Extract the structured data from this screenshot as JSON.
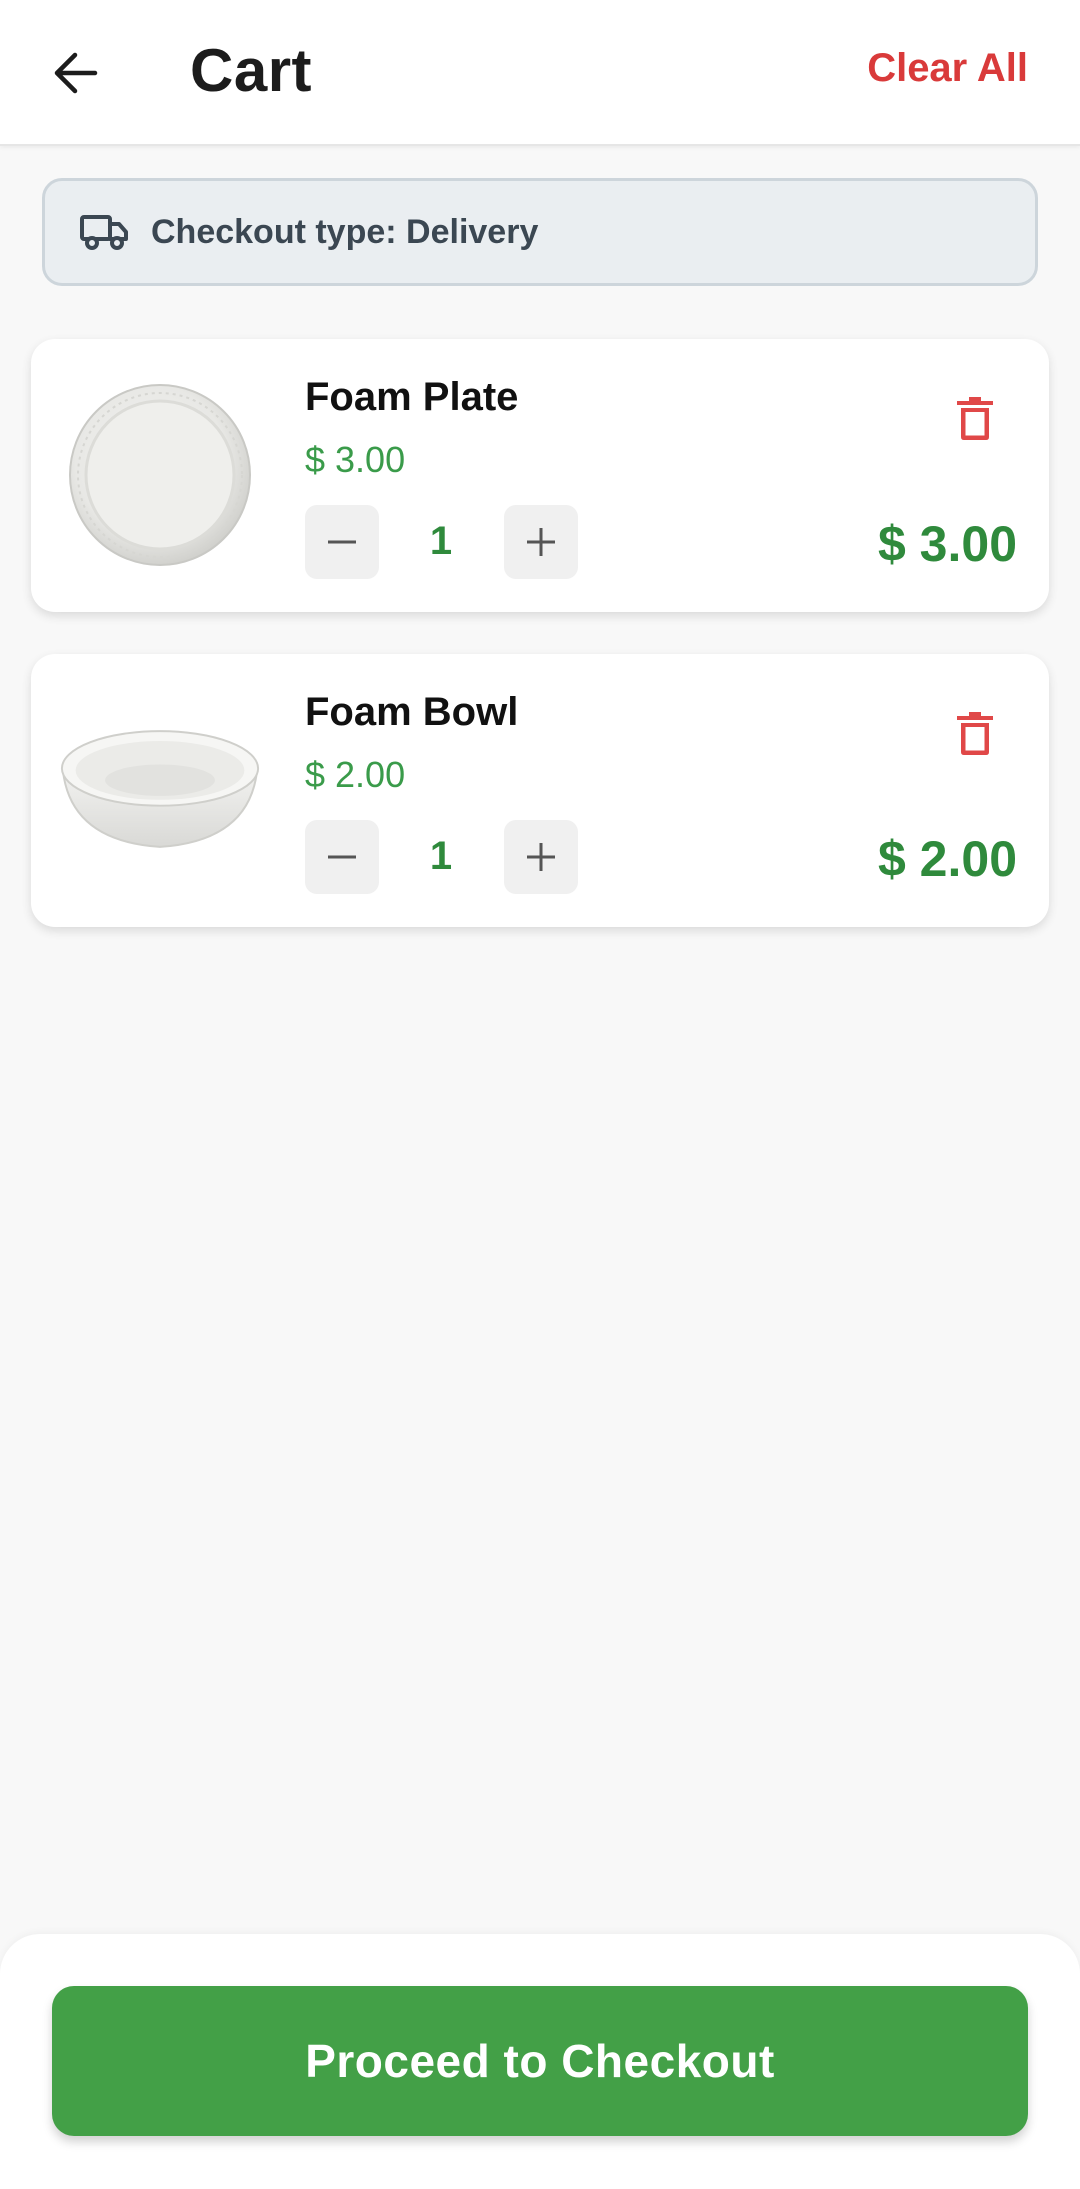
{
  "header": {
    "title": "Cart",
    "clear_all_label": "Clear All"
  },
  "checkout_type": {
    "label": "Checkout type: Delivery",
    "icon": "truck-icon"
  },
  "items": [
    {
      "name": "Foam Plate",
      "unit_price": "$ 3.00",
      "quantity": "1",
      "total": "$ 3.00",
      "image": "foam-plate"
    },
    {
      "name": "Foam Bowl",
      "unit_price": "$ 2.00",
      "quantity": "1",
      "total": "$ 2.00",
      "image": "foam-bowl"
    }
  ],
  "footer": {
    "checkout_label": "Proceed to Checkout"
  },
  "colors": {
    "accent_green": "#43a047",
    "price_green": "#2f8a3c",
    "danger_red": "#d93a3a"
  }
}
